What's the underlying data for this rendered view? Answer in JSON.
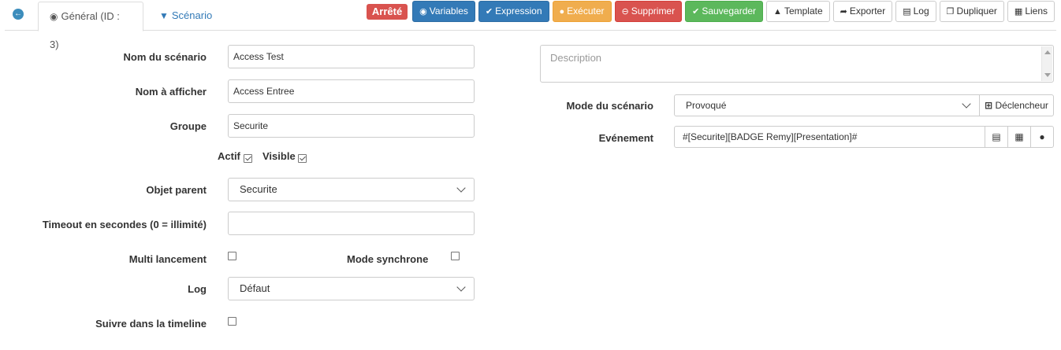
{
  "tabs": {
    "back_icon": "arrow-circle-left-icon",
    "general_label": "Général (ID : 3)",
    "scenario_label": "Scénario"
  },
  "toolbar": {
    "state_badge": "Arrêté",
    "variables": "Variables",
    "expression": "Expression",
    "executer": "Exécuter",
    "supprimer": "Supprimer",
    "sauvegarder": "Sauvegarder",
    "template": "Template",
    "exporter": "Exporter",
    "log": "Log",
    "dupliquer": "Dupliquer",
    "liens": "Liens"
  },
  "form": {
    "nom_scenario_label": "Nom du scénario",
    "nom_scenario_value": "Access Test",
    "nom_afficher_label": "Nom à afficher",
    "nom_afficher_value": "Access Entree",
    "groupe_label": "Groupe",
    "groupe_value": "Securite",
    "actif_label": "Actif",
    "actif_checked": true,
    "visible_label": "Visible",
    "visible_checked": true,
    "objet_parent_label": "Objet parent",
    "objet_parent_value": "Securite",
    "timeout_label": "Timeout en secondes (0 = illimité)",
    "timeout_value": "",
    "multi_lancement_label": "Multi lancement",
    "multi_lancement_checked": false,
    "mode_synchrone_label": "Mode synchrone",
    "mode_synchrone_checked": false,
    "log_label": "Log",
    "log_value": "Défaut",
    "timeline_label": "Suivre dans la timeline",
    "timeline_checked": false
  },
  "right": {
    "description_placeholder": "Description",
    "mode_label": "Mode du scénario",
    "mode_value": "Provoqué",
    "declencheur_button": "Déclencheur",
    "evenement_label": "Evénement",
    "evenement_value": "#[Securite][BADGE Remy][Presentation]#"
  },
  "colors": {
    "primary": "#337ab7",
    "danger": "#d9534f",
    "warning": "#f0ad4e",
    "success": "#5cb85c"
  }
}
